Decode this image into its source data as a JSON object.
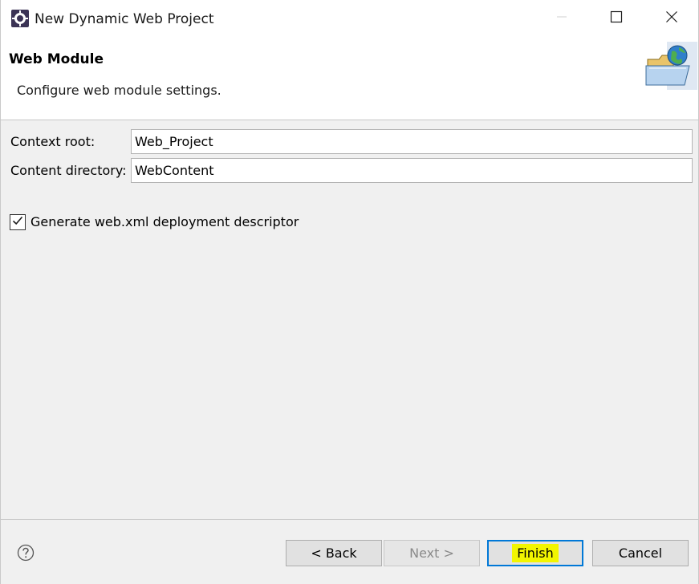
{
  "window": {
    "title": "New Dynamic Web Project",
    "icons": {
      "app": "eclipse-gear-icon",
      "minimize": "minimize-icon",
      "maximize": "maximize-icon",
      "close": "close-icon"
    }
  },
  "banner": {
    "title": "Web Module",
    "description": "Configure web module settings.",
    "image": "web-folder-globe-icon"
  },
  "form": {
    "context_root": {
      "label": "Context root:",
      "value": "Web_Project"
    },
    "content_directory": {
      "label": "Content directory:",
      "value": "WebContent"
    },
    "generate_descriptor": {
      "label": "Generate web.xml deployment descriptor",
      "checked": true
    }
  },
  "footer": {
    "help_icon": "help-question-icon",
    "back_label": "< Back",
    "next_label": "Next >",
    "finish_label": "Finish",
    "cancel_label": "Cancel",
    "next_enabled": false,
    "finish_highlight_color": "#f2f500"
  },
  "colors": {
    "accent_focus": "#0078d7",
    "background": "#f0f0f0",
    "header_background": "#ffffff"
  }
}
